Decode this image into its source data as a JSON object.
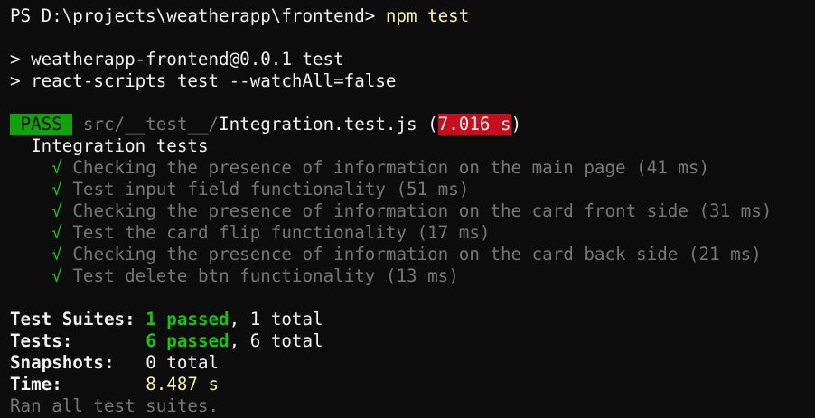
{
  "prompt": {
    "prefix": "PS D:\\projects\\weatherapp\\frontend> ",
    "command": "npm test"
  },
  "script_lines": [
    "> weatherapp-frontend@0.0.1 test",
    "> react-scripts test --watchAll=false"
  ],
  "result": {
    "status": "PASS",
    "path_dir": "src/__test__/",
    "file": "Integration.test.js",
    "paren_open": " (",
    "duration": "7.016 s",
    "paren_close": ")"
  },
  "describe_block": "Integration tests",
  "check_glyph": "√",
  "tests": [
    {
      "name": "Checking the presence of information on the main page",
      "time": "(41 ms)"
    },
    {
      "name": "Test input field functionality",
      "time": "(51 ms)"
    },
    {
      "name": "Checking the presence of information on the card front side",
      "time": "(31 ms)"
    },
    {
      "name": "Test the card flip functionality",
      "time": "(17 ms)"
    },
    {
      "name": "Checking the presence of information on the card back side",
      "time": "(21 ms)"
    },
    {
      "name": "Test delete btn functionality",
      "time": "(13 ms)"
    }
  ],
  "summary": {
    "suites_label": "Test Suites: ",
    "suites_passed": "1 passed",
    "suites_total": ", 1 total",
    "tests_label": "Tests:       ",
    "tests_passed": "6 passed",
    "tests_total": ", 6 total",
    "snapshots_label": "Snapshots:   ",
    "snapshots_value": "0 total",
    "time_label": "Time:        ",
    "time_value": "8.487 s",
    "footer": "Ran all test suites."
  },
  "colors": {
    "background": "#0c0c0c",
    "foreground": "#f2f2f2",
    "pass_bg": "#13a10e",
    "fail_time_bg": "#c50f1f",
    "green": "#16c60c",
    "yellow": "#f9f1a5",
    "dim": "#767676"
  }
}
